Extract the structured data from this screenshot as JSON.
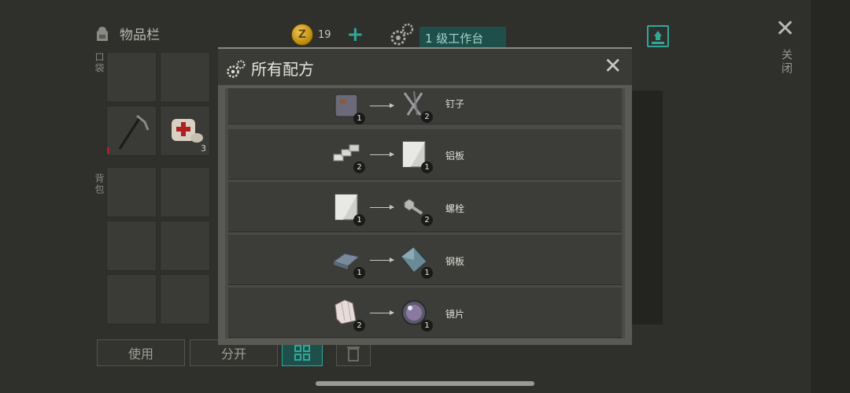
{
  "inventory": {
    "title": "物品栏",
    "pocket_label": "口袋",
    "backpack_label": "背包",
    "slot_item_count": "3"
  },
  "currency": {
    "coins": "19"
  },
  "workbench": {
    "label": "1 级工作台"
  },
  "close": {
    "label": "关闭"
  },
  "bottom_bar": {
    "use_label": "使用",
    "split_label": "分开"
  },
  "modal": {
    "title": "所有配方",
    "recipes": [
      {
        "input_icon": "metal-scrap-icon",
        "input_qty": "1",
        "output_icon": "nails-icon",
        "output_qty": "2",
        "name": "钉子"
      },
      {
        "input_icon": "aluminum-ingot-icon",
        "input_qty": "2",
        "output_icon": "aluminum-plate-icon",
        "output_qty": "1",
        "name": "铝板"
      },
      {
        "input_icon": "aluminum-plate-icon",
        "input_qty": "1",
        "output_icon": "bolt-icon",
        "output_qty": "2",
        "name": "螺栓"
      },
      {
        "input_icon": "steel-ingot-icon",
        "input_qty": "1",
        "output_icon": "steel-plate-icon",
        "output_qty": "1",
        "name": "钢板"
      },
      {
        "input_icon": "crystal-shard-icon",
        "input_qty": "2",
        "output_icon": "lens-icon",
        "output_qty": "1",
        "name": "镜片"
      }
    ]
  },
  "colors": {
    "accent_teal": "#2fa89a",
    "modal_bg": "#5a5a55"
  }
}
